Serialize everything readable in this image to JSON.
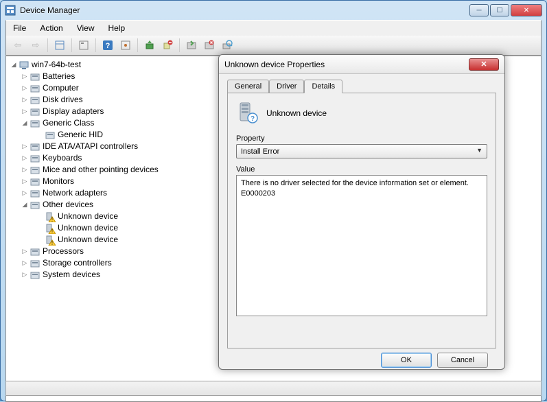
{
  "window": {
    "title": "Device Manager",
    "menu": {
      "file": "File",
      "action": "Action",
      "view": "View",
      "help": "Help"
    }
  },
  "tree": {
    "root": "win7-64b-test",
    "items": [
      {
        "label": "Batteries",
        "expanded_marker": "▷"
      },
      {
        "label": "Computer",
        "expanded_marker": "▷"
      },
      {
        "label": "Disk drives",
        "expanded_marker": "▷"
      },
      {
        "label": "Display adapters",
        "expanded_marker": "▷"
      },
      {
        "label": "Generic Class",
        "expanded_marker": "◢",
        "children": [
          {
            "label": "Generic HID"
          }
        ]
      },
      {
        "label": "IDE ATA/ATAPI controllers",
        "expanded_marker": "▷"
      },
      {
        "label": "Keyboards",
        "expanded_marker": "▷"
      },
      {
        "label": "Mice and other pointing devices",
        "expanded_marker": "▷"
      },
      {
        "label": "Monitors",
        "expanded_marker": "▷"
      },
      {
        "label": "Network adapters",
        "expanded_marker": "▷"
      },
      {
        "label": "Other devices",
        "expanded_marker": "◢",
        "children": [
          {
            "label": "Unknown device"
          },
          {
            "label": "Unknown device"
          },
          {
            "label": "Unknown device"
          }
        ]
      },
      {
        "label": "Processors",
        "expanded_marker": "▷"
      },
      {
        "label": "Storage controllers",
        "expanded_marker": "▷"
      },
      {
        "label": "System devices",
        "expanded_marker": "▷"
      }
    ]
  },
  "dialog": {
    "title": "Unknown device Properties",
    "device_name": "Unknown device",
    "tabs": {
      "general": "General",
      "driver": "Driver",
      "details": "Details"
    },
    "property_label": "Property",
    "property_value": "Install Error",
    "value_label": "Value",
    "value_lines": {
      "line1": "There is no driver selected for the device information set or element.",
      "line2": "E0000203"
    },
    "ok": "OK",
    "cancel": "Cancel"
  }
}
